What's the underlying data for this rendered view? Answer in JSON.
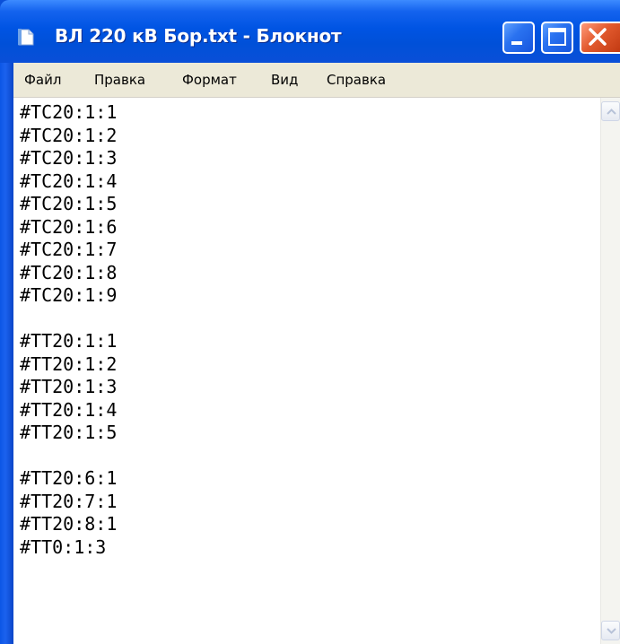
{
  "window": {
    "title": "ВЛ 220 кВ Бор.txt - Блокнот",
    "icon": "notepad-icon",
    "controls": [
      "minimize-icon",
      "maximize-icon",
      "close-icon"
    ]
  },
  "menu": {
    "items": [
      "Файл",
      "Правка",
      "Формат",
      "Вид",
      "Справка"
    ]
  },
  "document": {
    "lines": [
      "#TC20:1:1",
      "#TC20:1:2",
      "#TC20:1:3",
      "#TC20:1:4",
      "#TC20:1:5",
      "#TC20:1:6",
      "#TC20:1:7",
      "#TC20:1:8",
      "#TC20:1:9",
      "",
      "#TT20:1:1",
      "#TT20:1:2",
      "#TT20:1:3",
      "#TT20:1:4",
      "#TT20:1:5",
      "",
      "#TT20:6:1",
      "#TT20:7:1",
      "#TT20:8:1",
      "#TT0:1:3"
    ]
  },
  "scrollbar": {
    "up_icon": "scroll-up-arrow-icon",
    "down_icon": "scroll-down-arrow-icon"
  },
  "colors": {
    "titlebar": "#0054e3",
    "close_button": "#e25a2e",
    "menubar": "#ece9d8",
    "editor_background": "#ffffff"
  }
}
